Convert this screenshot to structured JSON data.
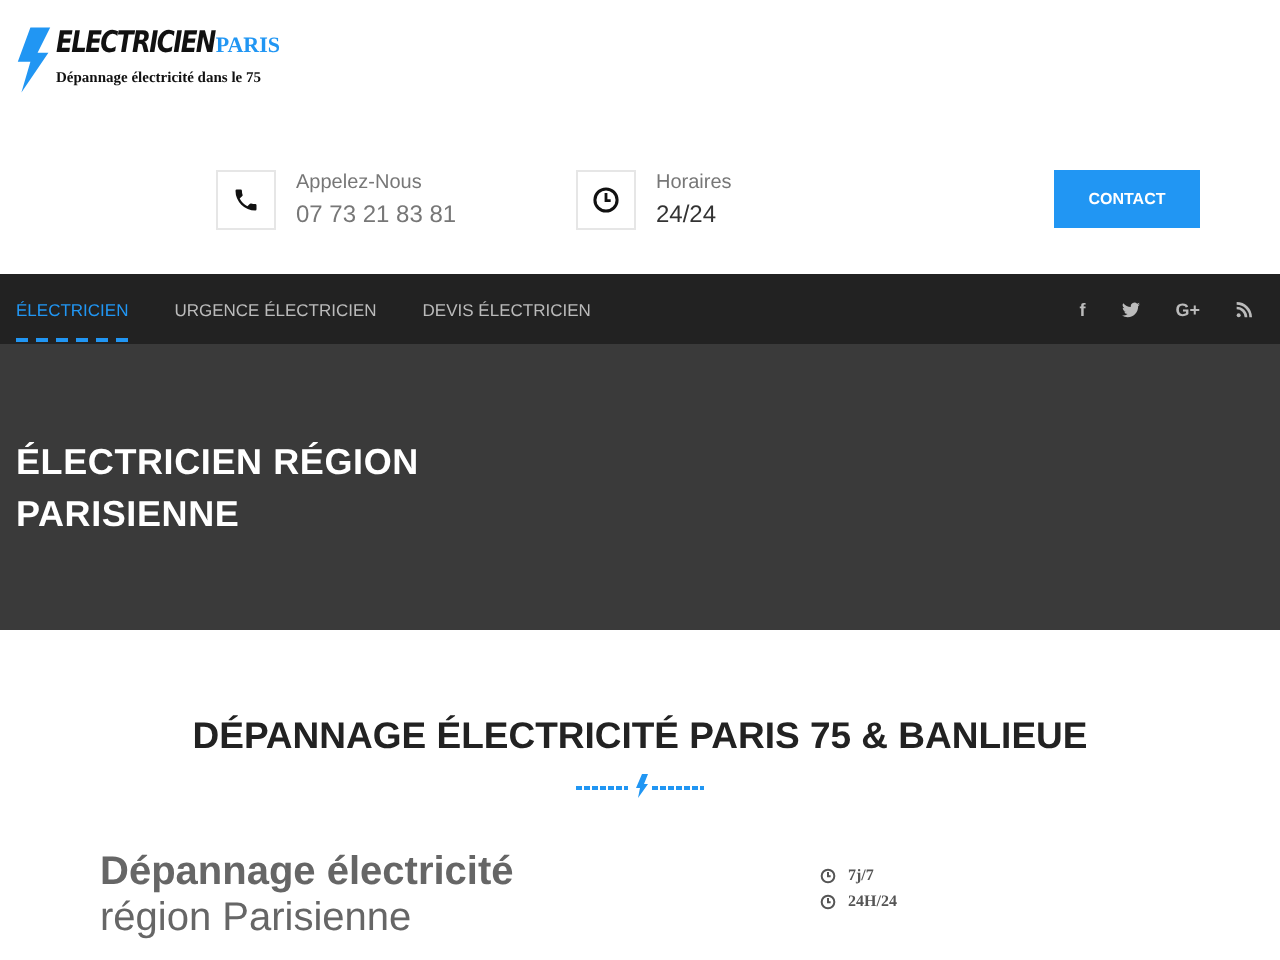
{
  "logo": {
    "name": "ELECTRICIEN",
    "city": "PARIS",
    "tagline": "Dépannage électricité dans le 75"
  },
  "contacts": [
    {
      "kind": "phone",
      "label": "Appelez-Nous",
      "value": "07 73 21 83 81"
    },
    {
      "kind": "clock",
      "label": "Horaires",
      "value": "24/24"
    }
  ],
  "contact_button": "CONTACT",
  "nav": {
    "items": [
      {
        "label": "ÉLECTRICIEN",
        "selected": true
      },
      {
        "label": "URGENCE ÉLECTRICIEN",
        "selected": false
      },
      {
        "label": "DEVIS ÉLECTRICIEN",
        "selected": false
      }
    ],
    "social": [
      {
        "kind": "text",
        "label": "f"
      },
      {
        "kind": "bird"
      },
      {
        "kind": "text",
        "label": "G+"
      },
      {
        "kind": "rss"
      }
    ]
  },
  "hero": {
    "title": "ÉLECTRICIEN RÉGION PARISIENNE"
  },
  "section": {
    "title": "DÉPANNAGE ÉLECTRICITÉ PARIS 75 & BANLIEUE"
  },
  "content": {
    "heading": "Dépannage électricité",
    "subheading": "région Parisienne",
    "hours": [
      "7j/7",
      "24H/24"
    ]
  }
}
